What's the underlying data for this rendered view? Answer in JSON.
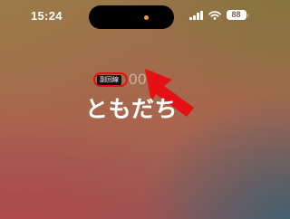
{
  "status_bar": {
    "time": "15:24",
    "battery": "88",
    "icons": [
      "signal-icon",
      "wifi-icon",
      "battery-icon"
    ]
  },
  "dynamic_island": {
    "indicator_color": "#f39c34"
  },
  "call": {
    "label": "副回線",
    "timer": "00:",
    "name": "ともだち"
  },
  "annotation": {
    "color": "#e60f14"
  }
}
